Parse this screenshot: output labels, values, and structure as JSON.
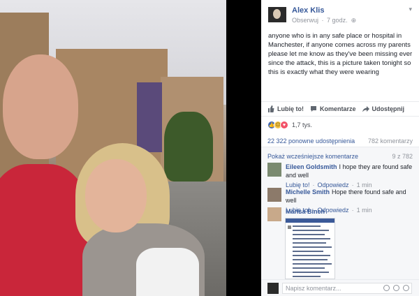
{
  "post": {
    "author": "Alex Klis",
    "follow_label": "Obserwuj",
    "time": "7 godz.",
    "text": "anyone who is in any safe place or hospital in Manchester, if anyone comes across my parents please let me know as they've been missing ever since the attack, this is a picture taken tonight so this is exactly what they were wearing",
    "photo_icon": "photo-of-missing-couple"
  },
  "actions": {
    "like": "Lubię to!",
    "comment": "Komentarze",
    "share": "Udostępnij"
  },
  "reactions": {
    "count": "1,7 tys.",
    "types": [
      "like",
      "sad",
      "love"
    ]
  },
  "stats": {
    "shares": "22 322 ponowne udostępnienia",
    "comments": "782 komentarzy"
  },
  "comments": {
    "prev_label": "Pokaż wcześniejsze komentarze",
    "pager": "9 z 782",
    "reply_label": "Odpowiedz",
    "like_label": "Lubię to!",
    "items": [
      {
        "name": "Eileen Goldsmith",
        "text": "I hope they are found safe and well",
        "time": "1 min"
      },
      {
        "name": "Michelle Smith",
        "text": "Hope there found safe and well",
        "time": "1 min"
      },
      {
        "name": "Marisa Binch",
        "text": "",
        "time": ""
      }
    ],
    "placeholder": "Napisz komentarz..."
  },
  "colors": {
    "link": "#365899",
    "muted": "#90949c",
    "like": "#4267b2",
    "love": "#f25268",
    "sad": "#f7c64b"
  }
}
